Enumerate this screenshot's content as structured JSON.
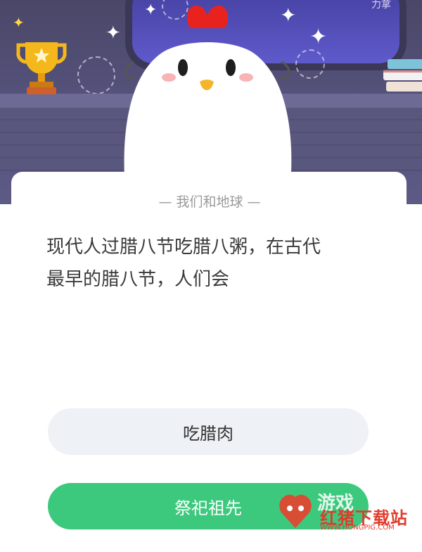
{
  "header": {
    "window_label": "力拿"
  },
  "card": {
    "title": "— 我们和地球 —",
    "question_line1": "现代人过腊八节吃腊八粥，在古代",
    "question_line2": "最早的腊八节，人们会"
  },
  "options": [
    {
      "label": "吃腊肉",
      "selected": false
    },
    {
      "label": "祭祀祖先",
      "selected": true
    }
  ],
  "watermark": {
    "line1": "游戏",
    "line2": "红猪下载站",
    "line3": "WWW.HONGPIG.COM"
  },
  "colors": {
    "scene_bg": "#54517a",
    "option_default_bg": "#eef1f5",
    "option_selected_bg": "#3dc97d",
    "watermark_red": "#e23a2a"
  }
}
